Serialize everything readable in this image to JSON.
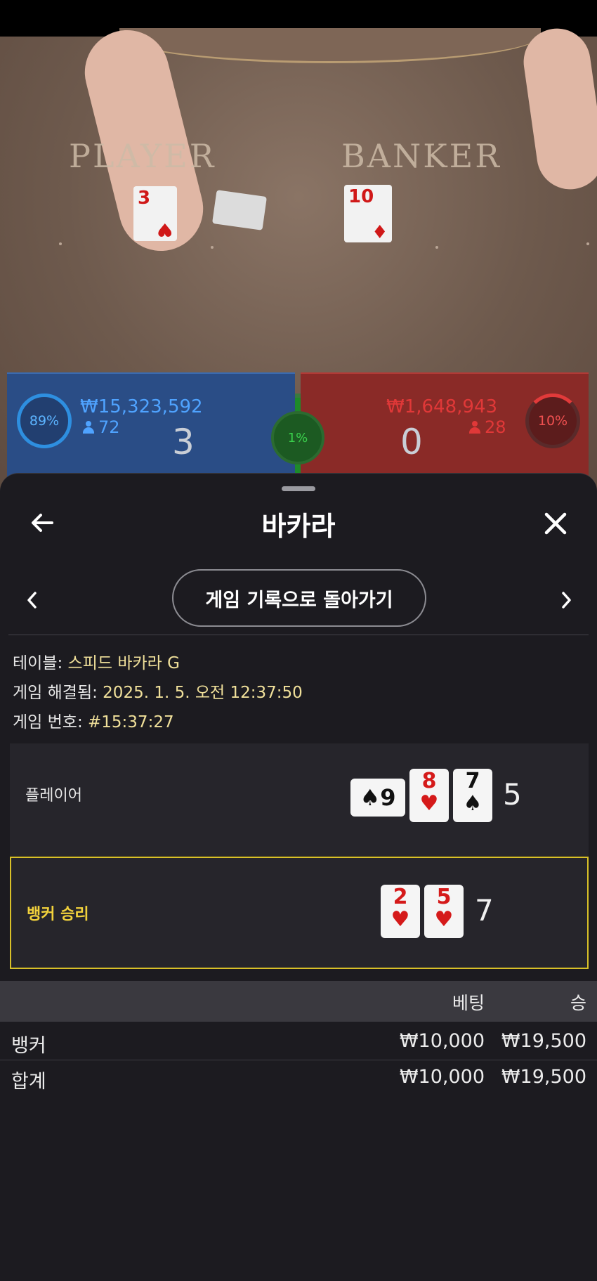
{
  "video": {
    "felt_player": "PLAYER",
    "felt_banker": "BANKER",
    "player_card_rank": "3",
    "banker_card_rank": "10"
  },
  "stats": {
    "player": {
      "percent": "89%",
      "amount": "₩15,323,592",
      "count": "72",
      "score": "3",
      "color": "#2a4d86"
    },
    "tie": {
      "percent": "1%",
      "color": "#1e8a2a"
    },
    "banker": {
      "percent": "10%",
      "amount": "₩1,648,943",
      "count": "28",
      "score": "0",
      "color": "#8a2a27"
    }
  },
  "sheet": {
    "title": "바카라",
    "back_icon": "arrow-left-icon",
    "close_icon": "close-icon",
    "history_button": "게임 기록으로 돌아가기",
    "info": {
      "table_label": "테이블: ",
      "table_value": "스피드 바카라 G",
      "resolved_label": "게임 해결됨: ",
      "resolved_value": "2025. 1. 5. 오전 12:37:50",
      "number_label": "게임 번호: ",
      "number_value": "#15:37:27"
    },
    "hands": {
      "player": {
        "label": "플레이어",
        "cards": [
          {
            "rank": "9",
            "suit": "♠"
          },
          {
            "rank": "8",
            "suit": "♥"
          },
          {
            "rank": "7",
            "suit": "♠"
          }
        ],
        "total": "5"
      },
      "banker": {
        "label": "뱅커 승리",
        "cards": [
          {
            "rank": "2",
            "suit": "♥"
          },
          {
            "rank": "5",
            "suit": "♥"
          }
        ],
        "total": "7",
        "highlight_color": "#d8c028"
      }
    },
    "bets": {
      "headers": {
        "bet": "베팅",
        "win": "승"
      },
      "rows": [
        {
          "name": "뱅커",
          "bet": "₩10,000",
          "win": "₩19,500"
        }
      ],
      "total": {
        "name": "합계",
        "bet": "₩10,000",
        "win": "₩19,500"
      }
    }
  }
}
